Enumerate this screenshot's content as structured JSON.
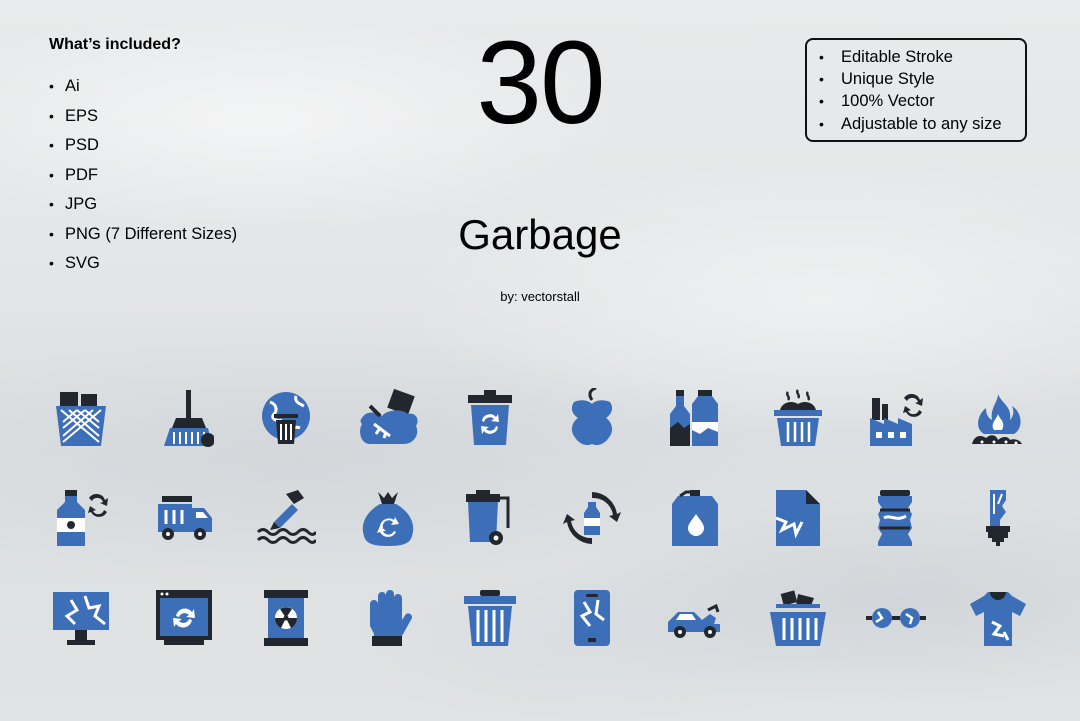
{
  "included": {
    "title": "What’s included?",
    "formats": [
      "Ai",
      "EPS",
      "PSD",
      "PDF",
      "JPG",
      "PNG (7 Different Sizes)",
      "SVG"
    ]
  },
  "count": "30",
  "title": "Garbage",
  "byline": "by: vectorstall",
  "features": [
    "Editable Stroke",
    "Unique Style",
    "100% Vector",
    "Adjustable to any size"
  ],
  "bullet": "•",
  "colors": {
    "icon_blue": "#3d6fb8",
    "icon_dark": "#22272e"
  },
  "icons": [
    [
      "wastebasket-icon",
      "broom-icon",
      "earth-trash-icon",
      "garbage-bag-leaf-icon",
      "recycle-bin-icon",
      "apple-core-icon",
      "bottles-icon",
      "smelly-bin-icon",
      "factory-recycle-icon",
      "fire-waste-icon"
    ],
    [
      "bottle-recycle-icon",
      "garbage-truck-icon",
      "water-pollution-icon",
      "recycle-sack-icon",
      "wheelie-bin-icon",
      "bottle-recycle-circle-icon",
      "jerrycan-icon",
      "torn-paper-icon",
      "crushed-can-icon",
      "broken-bulb-icon"
    ],
    [
      "broken-monitor-icon",
      "computer-recycle-icon",
      "radioactive-barrel-icon",
      "glove-icon",
      "trash-can-icon",
      "broken-phone-icon",
      "wrecked-car-icon",
      "basket-trash-icon",
      "broken-glasses-icon",
      "torn-shirt-icon"
    ]
  ]
}
